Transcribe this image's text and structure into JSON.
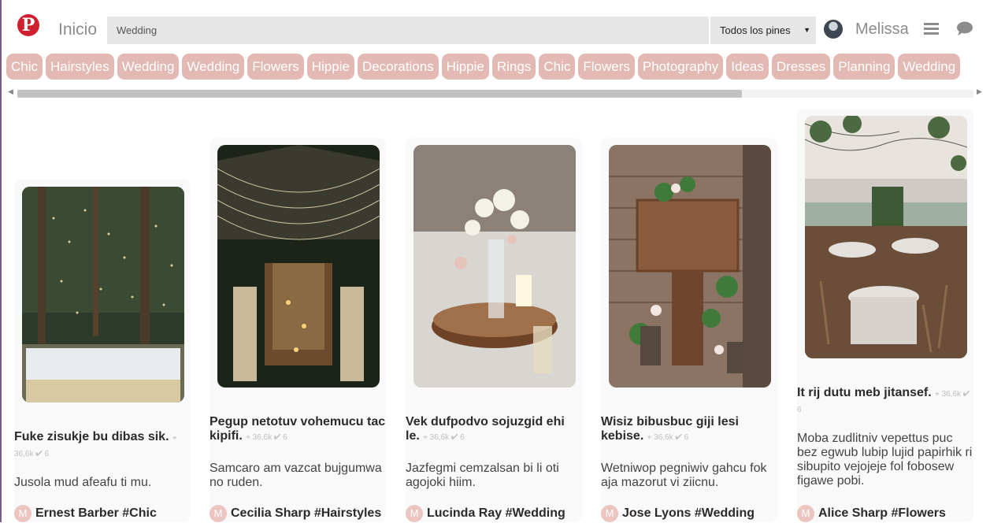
{
  "header": {
    "home_label": "Inicio",
    "search_value": "Wedding",
    "filter_selected": "Todos los pines",
    "username": "Melissa",
    "logo_icon": "pinterest-logo",
    "brand_color": "#d01f2e"
  },
  "tags": [
    "Chic",
    "Hairstyles",
    "Wedding",
    "Wedding",
    "Flowers",
    "Hippie",
    "Decorations",
    "Hippie",
    "Rings",
    "Chic",
    "Flowers",
    "Photography",
    "Ideas",
    "Dresses",
    "Planning",
    "Wedding"
  ],
  "tag_color": "#e3b9b3",
  "pins": [
    {
      "title": "Fuke zisukje bu dibas sik.",
      "saves": "36,6k",
      "likes": "6",
      "description": "Jusola mud afeafu ti mu.",
      "author_initial": "M",
      "author": "Ernest Barber",
      "tag": "#Chic"
    },
    {
      "title": "Pegup netotuv vohemucu tac kipifi.",
      "saves": "36,6k",
      "likes": "6",
      "description": "Samcaro am vazcat bujgumwa no ruden.",
      "author_initial": "M",
      "author": "Cecilia Sharp",
      "tag": "#Hairstyles"
    },
    {
      "title": "Vek dufpodvo sojuzgid ehi le.",
      "saves": "36,6k",
      "likes": "6",
      "description": "Jazfegmi cemzalsan bi li oti agojoki hiim.",
      "author_initial": "M",
      "author": "Lucinda Ray",
      "tag": "#Wedding"
    },
    {
      "title": "Wisiz bibusbuc giji lesi kebise.",
      "saves": "36,6k",
      "likes": "6",
      "description": "Wetniwop pegniwiv gahcu fok aja mazorut vi ziicnu.",
      "author_initial": "M",
      "author": "Jose Lyons",
      "tag": "#Wedding"
    },
    {
      "title": "It rij dutu meb jitansef.",
      "saves": "36,6k",
      "likes": "6",
      "description": "Moba zudlitniv vepettus puc bez egwub lubip lujid papirhik ri sibupito vejojeje fol fobosew figawe pobi.",
      "author_initial": "M",
      "author": "Alice Sharp",
      "tag": "#Flowers"
    }
  ]
}
